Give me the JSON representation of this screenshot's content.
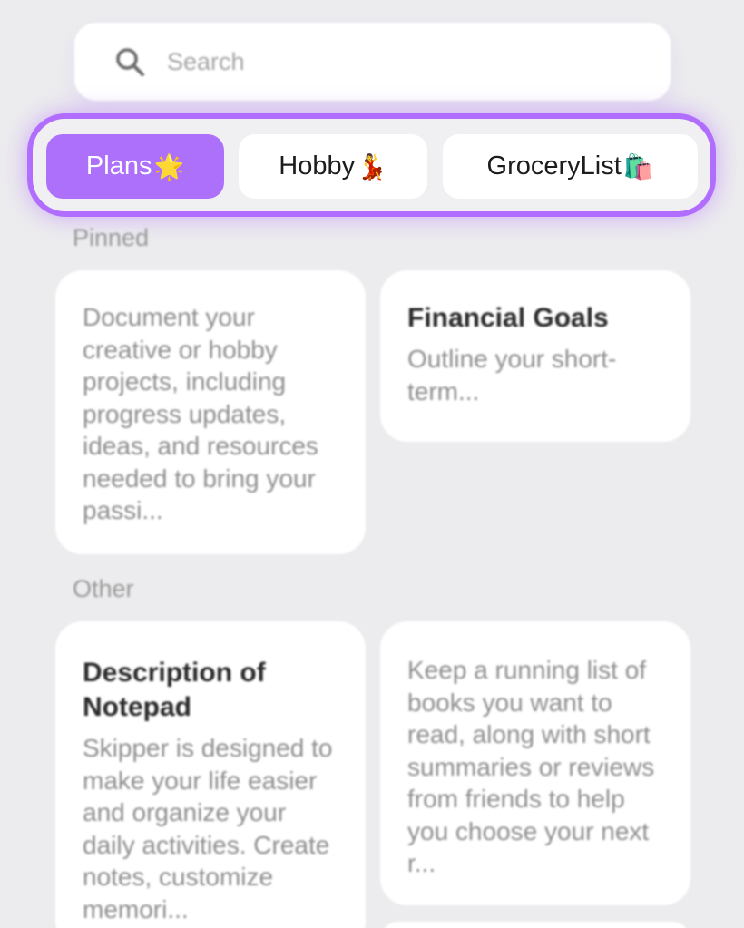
{
  "search": {
    "icon": "search-icon",
    "placeholder": "Search"
  },
  "tabs": [
    {
      "label": "Plans",
      "emoji": "🌟",
      "active": true
    },
    {
      "label": "Hobby",
      "emoji": "💃",
      "active": false
    },
    {
      "label": "GroceryList",
      "emoji": "🛍️",
      "active": false
    }
  ],
  "sections": {
    "pinned_label": "Pinned",
    "other_label": "Other"
  },
  "notes": {
    "pinned": [
      {
        "title": "",
        "body": "Document your creative or hobby projects, including progress updates, ideas, and resources needed to bring your passi..."
      },
      {
        "title": "Financial Goals",
        "body": "Outline your short-term..."
      }
    ],
    "other": [
      {
        "title": "Description of Notepad",
        "body": "Skipper is designed to make your life easier and organize your daily activities. Create notes, customize memori..."
      },
      {
        "title": "",
        "body": "Keep a running list of books you want to read, along with short summaries or reviews from friends to help you choose your next r..."
      }
    ]
  },
  "colors": {
    "accent": "#ad70fb",
    "accent_border": "#b16dfd",
    "background": "#ececee"
  }
}
